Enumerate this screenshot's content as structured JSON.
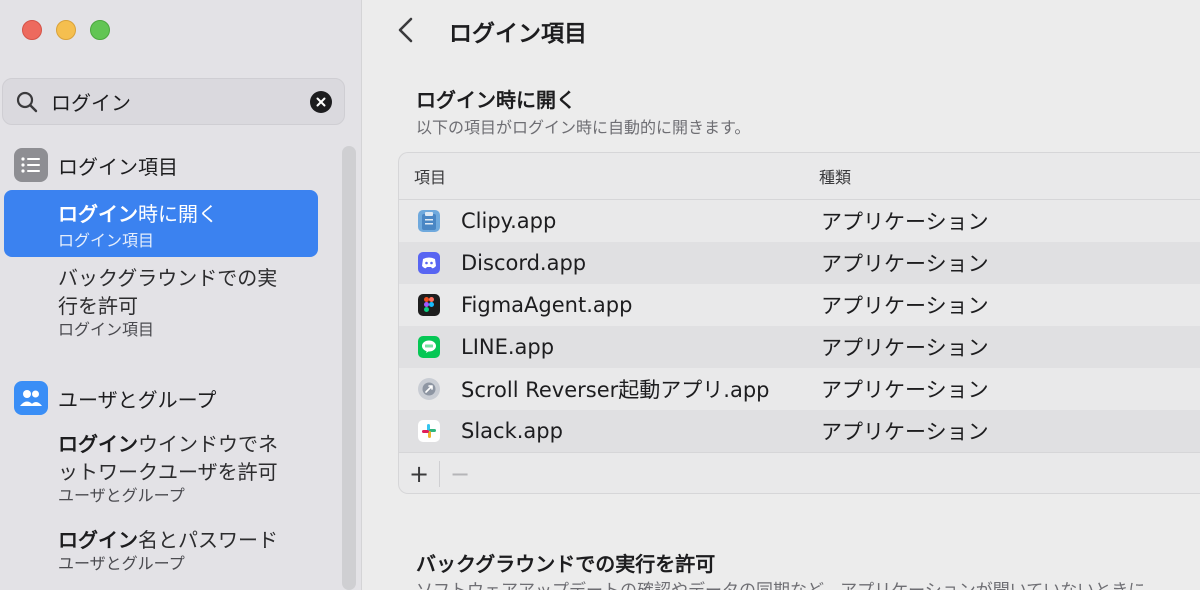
{
  "search": {
    "query": "ログイン"
  },
  "sidebar": {
    "sections": [
      {
        "label": "ログイン項目",
        "icon": "list-icon",
        "color": "#8e8e93"
      },
      {
        "label": "ユーザとグループ",
        "icon": "users-icon",
        "color": "#3a8ef6"
      }
    ],
    "items": [
      {
        "match": "ログイン",
        "rest": "時に開く",
        "sub": "ログイン項目",
        "selected": true
      },
      {
        "line1": "バックグラウンドでの実",
        "line2": "行を許可",
        "sub": "ログイン項目"
      },
      {
        "match": "ログイン",
        "rest": "ウインドウでネ",
        "line2": "ットワークユーザを許可",
        "sub": "ユーザとグループ"
      },
      {
        "match": "ログイン",
        "rest": "名とパスワード",
        "sub": "ユーザとグループ"
      }
    ]
  },
  "main": {
    "title": "ログイン項目",
    "open_at_login": {
      "heading": "ログイン時に開く",
      "description": "以下の項目がログイン時に自動的に開きます。",
      "columns": [
        "項目",
        "種類"
      ],
      "rows": [
        {
          "name": "Clipy.app",
          "kind": "アプリケーション",
          "icon": "clipy-icon"
        },
        {
          "name": "Discord.app",
          "kind": "アプリケーション",
          "icon": "discord-icon"
        },
        {
          "name": "FigmaAgent.app",
          "kind": "アプリケーション",
          "icon": "figma-icon"
        },
        {
          "name": "LINE.app",
          "kind": "アプリケーション",
          "icon": "line-icon"
        },
        {
          "name": "Scroll Reverser起動アプリ.app",
          "kind": "アプリケーション",
          "icon": "scroll-reverser-icon"
        },
        {
          "name": "Slack.app",
          "kind": "アプリケーション",
          "icon": "slack-icon"
        }
      ],
      "add_label": "+",
      "remove_label": "−"
    },
    "background": {
      "heading": "バックグラウンドでの実行を許可",
      "description": "ソフトウェアアップデートの確認やデータの同期など、アプリケーションが開いていないときに"
    }
  }
}
